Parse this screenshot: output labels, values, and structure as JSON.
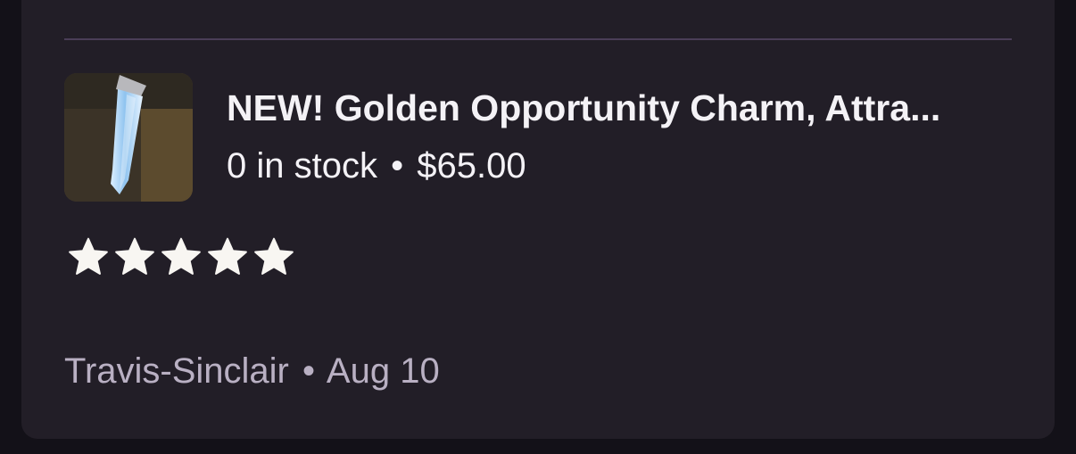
{
  "review": {
    "product": {
      "image_icon": "crystal-pendant-image",
      "title": "NEW! Golden Opportunity Charm, Attra...",
      "stock": "0 in stock",
      "separator": "•",
      "price": "$65.00"
    },
    "rating": {
      "stars": 5,
      "max": 5,
      "icon": "star-icon"
    },
    "author": "Travis-Sinclair",
    "separator": "•",
    "date": "Aug 10"
  },
  "colors": {
    "card_bg": "#221e27",
    "page_bg": "#131118",
    "divider": "#4a3e57",
    "text_primary": "#f4f2f6",
    "text_secondary": "#b9b0c3"
  }
}
